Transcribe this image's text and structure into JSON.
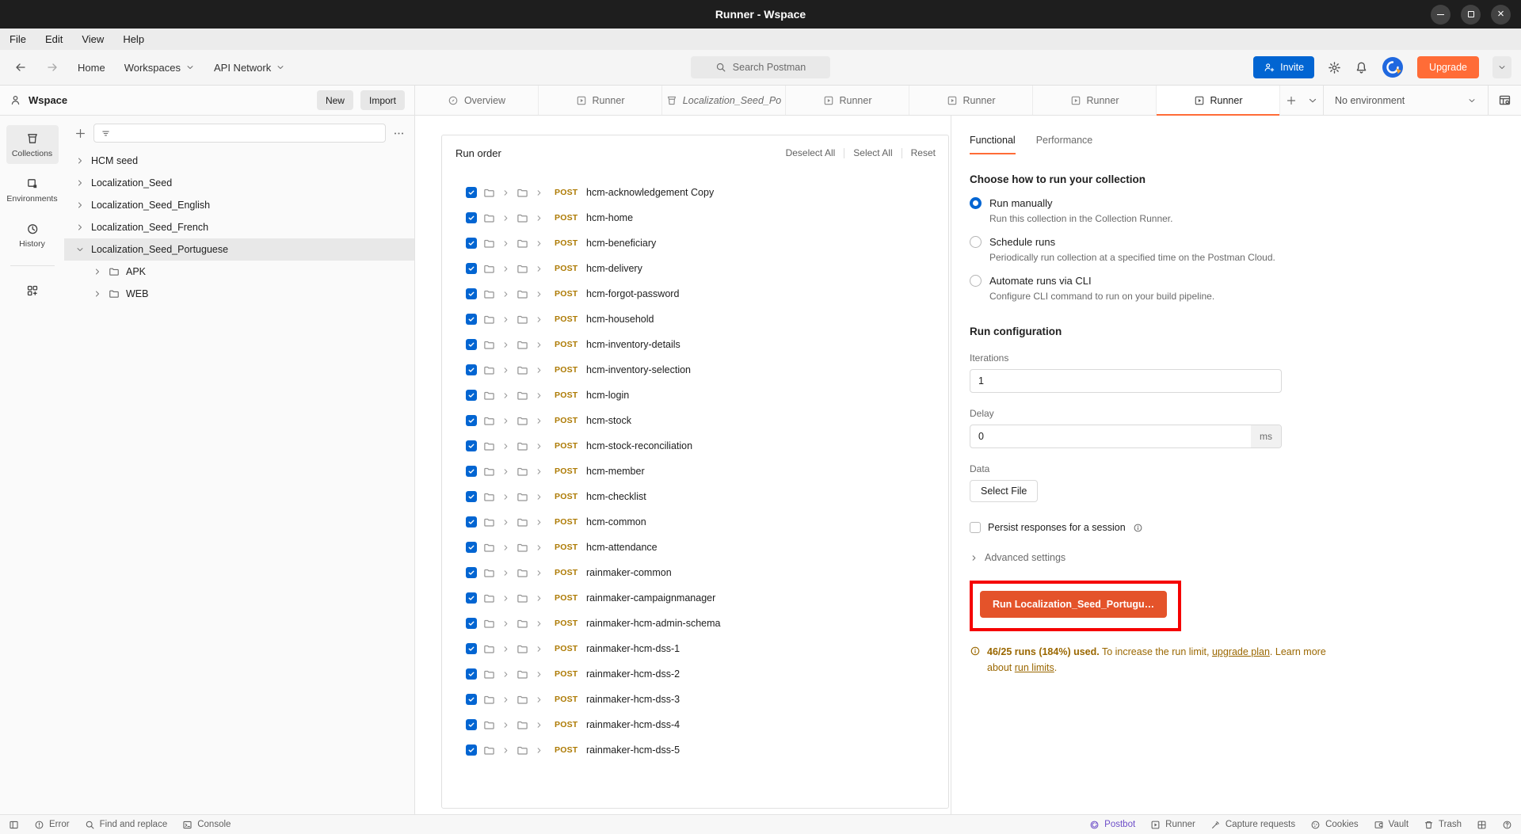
{
  "titlebar": {
    "title": "Runner - Wspace"
  },
  "menubar": {
    "items": [
      "File",
      "Edit",
      "View",
      "Help"
    ]
  },
  "navbar": {
    "home": "Home",
    "workspaces": "Workspaces",
    "api_network": "API Network",
    "search_placeholder": "Search Postman",
    "invite_label": "Invite",
    "upgrade_label": "Upgrade"
  },
  "workspace_header": {
    "name": "Wspace",
    "new_label": "New",
    "import_label": "Import"
  },
  "rail": {
    "items": [
      {
        "label": "Collections",
        "icon": "collections",
        "active": true
      },
      {
        "label": "Environments",
        "icon": "environments",
        "active": false
      },
      {
        "label": "History",
        "icon": "history",
        "active": false
      }
    ],
    "extra_icon": "grid-plus"
  },
  "sidebar": {
    "tree": {
      "items": [
        {
          "label": "HCM seed",
          "chevron": "right",
          "folder": false,
          "indent": 0,
          "selected": false
        },
        {
          "label": "Localization_Seed",
          "chevron": "right",
          "folder": false,
          "indent": 0,
          "selected": false
        },
        {
          "label": "Localization_Seed_English",
          "chevron": "right",
          "folder": false,
          "indent": 0,
          "selected": false
        },
        {
          "label": "Localization_Seed_French",
          "chevron": "right",
          "folder": false,
          "indent": 0,
          "selected": false
        },
        {
          "label": "Localization_Seed_Portuguese",
          "chevron": "down",
          "folder": false,
          "indent": 0,
          "selected": true
        },
        {
          "label": "APK",
          "chevron": "right",
          "folder": true,
          "indent": 1,
          "selected": false
        },
        {
          "label": "WEB",
          "chevron": "right",
          "folder": true,
          "indent": 1,
          "selected": false
        }
      ]
    }
  },
  "tabs": {
    "items": [
      {
        "label": "Overview",
        "icon": "overview",
        "active": false,
        "italic": false
      },
      {
        "label": "Runner",
        "icon": "runner",
        "active": false,
        "italic": false
      },
      {
        "label": "Localization_Seed_Po",
        "icon": "collections",
        "active": false,
        "italic": true
      },
      {
        "label": "Runner",
        "icon": "runner",
        "active": false,
        "italic": false
      },
      {
        "label": "Runner",
        "icon": "runner",
        "active": false,
        "italic": false
      },
      {
        "label": "Runner",
        "icon": "runner",
        "active": false,
        "italic": false
      },
      {
        "label": "Runner",
        "icon": "runner",
        "active": true,
        "italic": false
      }
    ],
    "environment": "No environment"
  },
  "run_order": {
    "title": "Run order",
    "actions": [
      "Deselect All",
      "Select All",
      "Reset"
    ],
    "method": "POST",
    "items": [
      "hcm-acknowledgement Copy",
      "hcm-home",
      "hcm-beneficiary",
      "hcm-delivery",
      "hcm-forgot-password",
      "hcm-household",
      "hcm-inventory-details",
      "hcm-inventory-selection",
      "hcm-login",
      "hcm-stock",
      "hcm-stock-reconciliation",
      "hcm-member",
      "hcm-checklist",
      "hcm-common",
      "hcm-attendance",
      "rainmaker-common",
      "rainmaker-campaignmanager",
      "rainmaker-hcm-admin-schema",
      "rainmaker-hcm-dss-1",
      "rainmaker-hcm-dss-2",
      "rainmaker-hcm-dss-3",
      "rainmaker-hcm-dss-4",
      "rainmaker-hcm-dss-5"
    ]
  },
  "right_panel": {
    "tabs": [
      {
        "label": "Functional",
        "active": true
      },
      {
        "label": "Performance",
        "active": false
      }
    ],
    "choose_heading": "Choose how to run your collection",
    "options": [
      {
        "label": "Run manually",
        "desc": "Run this collection in the Collection Runner.",
        "selected": true
      },
      {
        "label": "Schedule runs",
        "desc": "Periodically run collection at a specified time on the Postman Cloud.",
        "selected": false
      },
      {
        "label": "Automate runs via CLI",
        "desc": "Configure CLI command to run on your build pipeline.",
        "selected": false
      }
    ],
    "run_config": {
      "heading": "Run configuration",
      "iterations_label": "Iterations",
      "iterations_value": "1",
      "delay_label": "Delay",
      "delay_value": "0",
      "delay_unit": "ms",
      "data_label": "Data",
      "select_file_label": "Select File",
      "persist_label": "Persist responses for a session",
      "advanced_label": "Advanced settings"
    },
    "run_button_label": "Run Localization_Seed_Portugu…",
    "warning": {
      "bold": "46/25 runs (184%) used.",
      "mid1": " To increase the run limit, ",
      "link1": "upgrade plan",
      "mid2": ". Learn more about ",
      "link2": "run limits",
      "end": "."
    }
  },
  "statusbar": {
    "left": [
      {
        "label": "",
        "icon": "sidebar-toggle",
        "accent": false
      },
      {
        "label": "Error",
        "icon": "error",
        "accent": false
      },
      {
        "label": "Find and replace",
        "icon": "search",
        "accent": false
      },
      {
        "label": "Console",
        "icon": "console",
        "accent": false
      }
    ],
    "right": [
      {
        "label": "Postbot",
        "icon": "postbot",
        "accent": true
      },
      {
        "label": "Runner",
        "icon": "runner",
        "accent": false
      },
      {
        "label": "Capture requests",
        "icon": "capture",
        "accent": false
      },
      {
        "label": "Cookies",
        "icon": "cookies",
        "accent": false
      },
      {
        "label": "Vault",
        "icon": "vault",
        "accent": false
      },
      {
        "label": "Trash",
        "icon": "trash",
        "accent": false
      },
      {
        "label": "",
        "icon": "split",
        "accent": false
      },
      {
        "label": "",
        "icon": "help",
        "accent": false
      }
    ]
  },
  "colors": {
    "accent_orange": "#ff6c37",
    "run_button_orange": "#e4532a",
    "primary_blue": "#0265d2",
    "post_method": "#ad7a03",
    "warning_text": "#9a6700",
    "highlight_red": "#f50000",
    "postbot_purple": "#6e4fc8"
  }
}
